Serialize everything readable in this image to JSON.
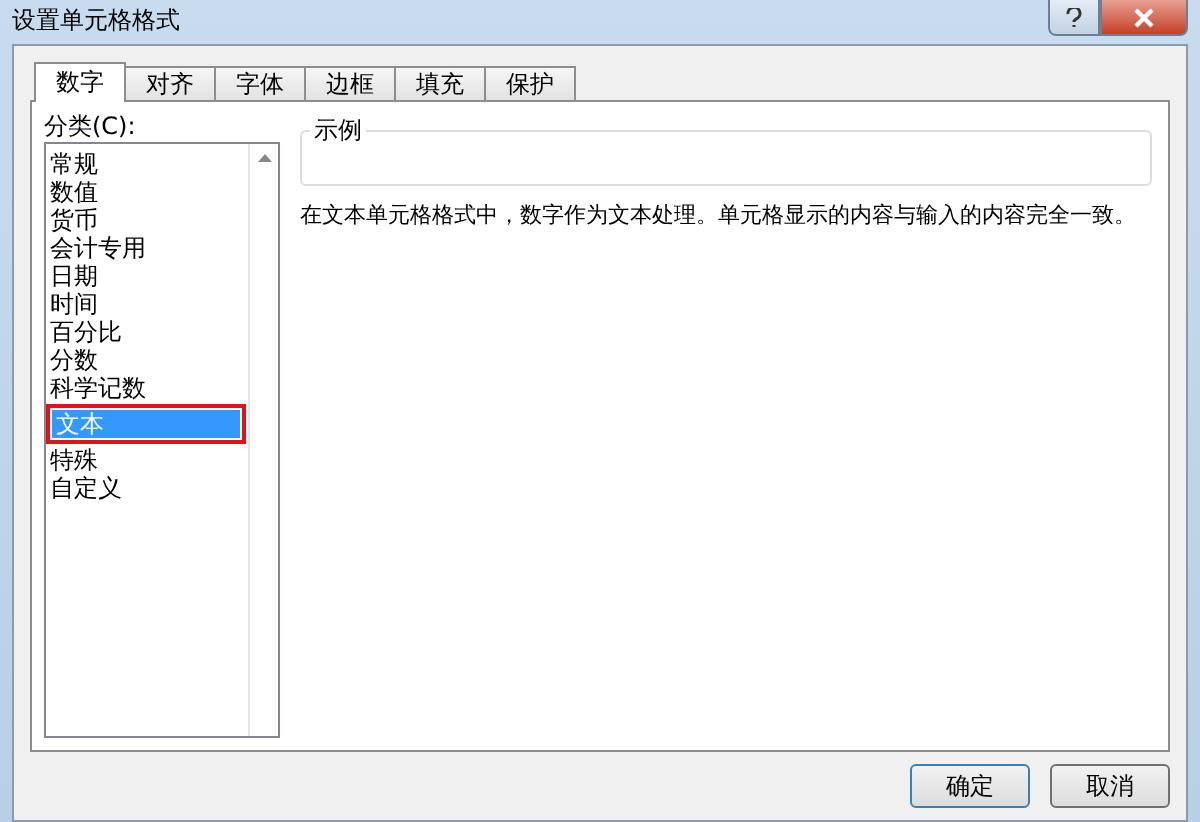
{
  "window": {
    "title": "设置单元格格式"
  },
  "tabs": [
    {
      "label": "数字",
      "selected": true
    },
    {
      "label": "对齐",
      "selected": false
    },
    {
      "label": "字体",
      "selected": false
    },
    {
      "label": "边框",
      "selected": false
    },
    {
      "label": "填充",
      "selected": false
    },
    {
      "label": "保护",
      "selected": false
    }
  ],
  "category": {
    "label": "分类(C):",
    "items": [
      {
        "label": "常规",
        "selected": false
      },
      {
        "label": "数值",
        "selected": false
      },
      {
        "label": "货币",
        "selected": false
      },
      {
        "label": "会计专用",
        "selected": false
      },
      {
        "label": "日期",
        "selected": false
      },
      {
        "label": "时间",
        "selected": false
      },
      {
        "label": "百分比",
        "selected": false
      },
      {
        "label": "分数",
        "selected": false
      },
      {
        "label": "科学记数",
        "selected": false
      },
      {
        "label": "文本",
        "selected": true
      },
      {
        "label": "特殊",
        "selected": false
      },
      {
        "label": "自定义",
        "selected": false
      }
    ]
  },
  "sample": {
    "label": "示例"
  },
  "description": "在文本单元格格式中，数字作为文本处理。单元格显示的内容与输入的内容完全一致。",
  "buttons": [
    "确定",
    "取消"
  ]
}
